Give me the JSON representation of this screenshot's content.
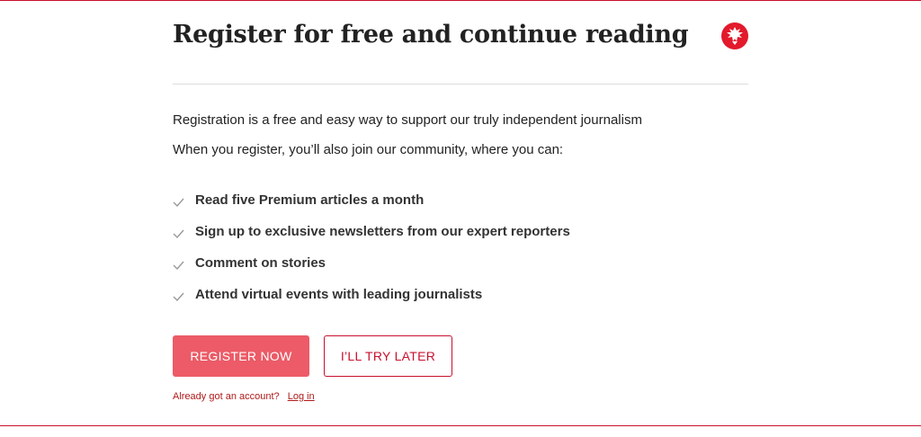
{
  "modal": {
    "title": "Register for free and continue reading",
    "logo_icon": "independent-eagle-icon",
    "intro": "Registration is a free and easy way to support our truly independent journalism",
    "intro_2": "When you register, you’ll also join our community, where you can:",
    "benefits": [
      "Read five Premium articles a month",
      "Sign up to exclusive newsletters from our expert reporters",
      "Comment on stories",
      "Attend virtual events with leading journalists"
    ],
    "register_label": "REGISTER NOW",
    "later_label": "I’LL TRY LATER",
    "login_prompt": "Already got an account?",
    "login_link": "Log in"
  },
  "colors": {
    "brand_red": "#c8102e",
    "primary_button": "#ec5b67",
    "check_icon": "#999999"
  }
}
